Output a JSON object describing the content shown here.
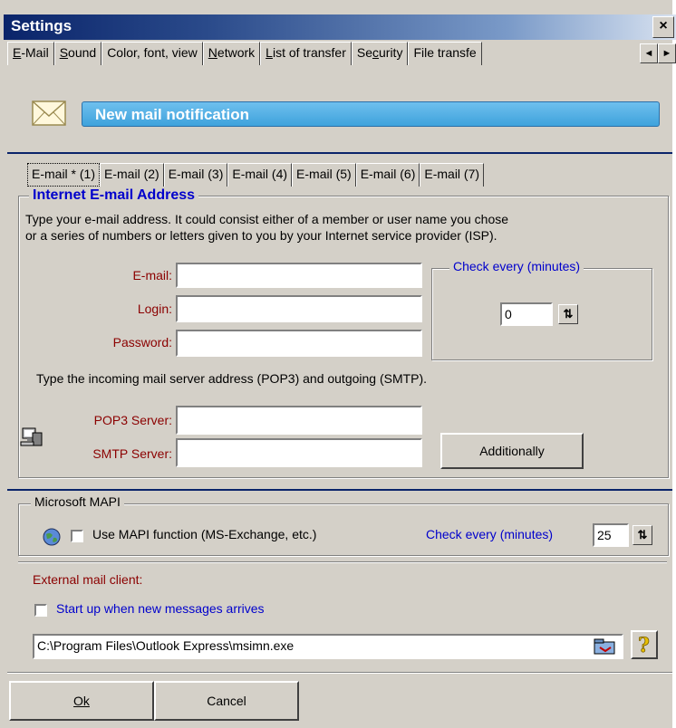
{
  "window": {
    "title": "Settings",
    "close": "×"
  },
  "main_tabs": [
    {
      "label": "E-Mail",
      "u": "E"
    },
    {
      "label": "Sound",
      "u": "S"
    },
    {
      "label": "Color, font, view",
      "u": ""
    },
    {
      "label": "Network",
      "u": "N"
    },
    {
      "label": "List of transfer",
      "u": "L"
    },
    {
      "label": "Security",
      "u": "c"
    },
    {
      "label": "File transfe",
      "u": ""
    }
  ],
  "scroll": {
    "left": "◄",
    "right": "►"
  },
  "banner": {
    "text": "New mail notification"
  },
  "sub_tabs": [
    "E-mail * (1)",
    "E-mail (2)",
    "E-mail (3)",
    "E-mail (4)",
    "E-mail (5)",
    "E-mail (6)",
    "E-mail (7)"
  ],
  "internet": {
    "legend": "Internet E-mail Address",
    "desc1": "Type your e-mail address. It could consist either of a member or user name you chose",
    "desc2": "or a series of numbers or letters given to you by your Internet service provider (ISP).",
    "email_label": "E-mail:",
    "email_value": "",
    "login_label": "Login:",
    "login_value": "",
    "password_label": "Password:",
    "password_value": "",
    "check_legend": "Check every (minutes)",
    "check_value": "0",
    "server_desc": "Type the incoming mail server address (POP3) and outgoing (SMTP).",
    "pop3_label": "POP3 Server:",
    "pop3_value": "",
    "smtp_label": "SMTP Server:",
    "smtp_value": "",
    "additionally": "Additionally"
  },
  "mapi": {
    "legend": "Microsoft MAPI",
    "use_label": "Use MAPI function (MS-Exchange, etc.)",
    "use_checked": false,
    "check_label": "Check every (minutes)",
    "check_value": "25"
  },
  "external": {
    "legend": "External mail client:",
    "startup_label": "Start up when new messages arrives",
    "startup_checked": false,
    "path": "C:\\Program Files\\Outlook Express\\msimn.exe"
  },
  "buttons": {
    "ok": "Ok",
    "cancel": "Cancel"
  },
  "colors": {
    "title_start": "#0a246a",
    "banner": "#3ea2dc",
    "label_red": "#8b0000",
    "accent_blue": "#0000cc"
  }
}
